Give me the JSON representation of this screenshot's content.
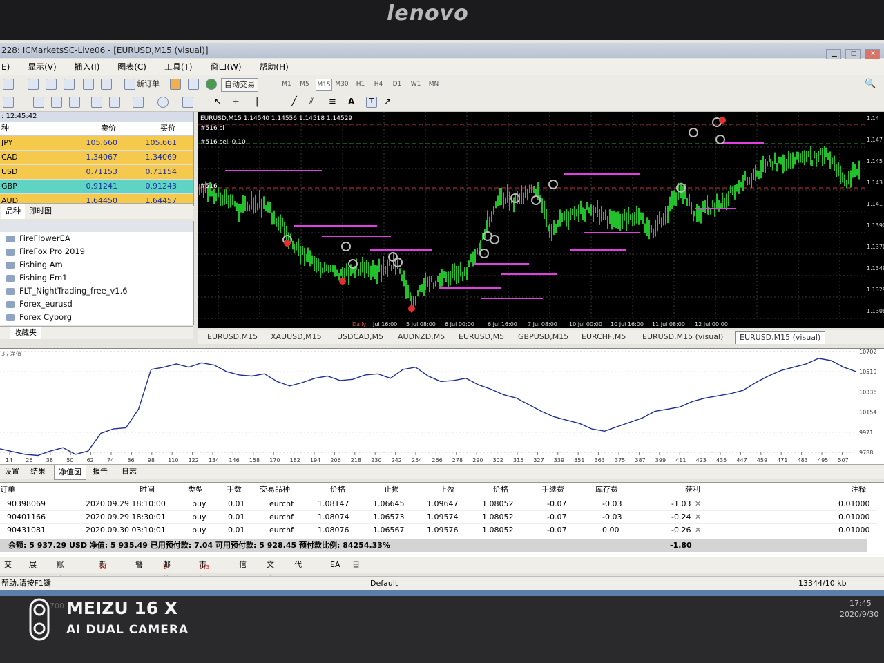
{
  "monitor": {
    "brand": "lenovo"
  },
  "watermark": {
    "line1": "MEIZU 16 X",
    "line2": "AI DUAL CAMERA"
  },
  "window": {
    "title": "228: ICMarketsSC-Live06 - [EURUSD,M15 (visual)]"
  },
  "menu": {
    "items": [
      "显示(V)",
      "插入(I)",
      "图表(C)",
      "工具(T)",
      "窗口(W)",
      "帮助(H)"
    ],
    "file": "E)"
  },
  "toolbar": {
    "new_order": "新订单",
    "auto_trading": "自动交易",
    "timeframes": [
      "M1",
      "M5",
      "M15",
      "M30",
      "H1",
      "H4",
      "D1",
      "W1",
      "MN"
    ],
    "active_timeframe": "M15",
    "text_tool": "A",
    "text_label_tool": "T"
  },
  "market_watch": {
    "time": ": 12:45:42",
    "col_symbol": "种",
    "col_bid": "卖价",
    "col_ask": "买价",
    "rows": [
      {
        "symbol": "JPY",
        "bid": "105.660",
        "ask": "105.661",
        "color": "#f5c94c"
      },
      {
        "symbol": "CAD",
        "bid": "1.34067",
        "ask": "1.34069",
        "color": "#f5c94c"
      },
      {
        "symbol": "USD",
        "bid": "0.71153",
        "ask": "0.71154",
        "color": "#f5c94c"
      },
      {
        "symbol": "GBP",
        "bid": "0.91241",
        "ask": "0.91243",
        "color": "#5fd3c4"
      },
      {
        "symbol": "AUD",
        "bid": "1.64450",
        "ask": "1.64457",
        "color": "#f5c94c"
      }
    ],
    "tabs": [
      "品种",
      "即时图"
    ]
  },
  "navigator": {
    "items": [
      "FireFlowerEA",
      "FireFox Pro 2019",
      "Fishing Am",
      "Fishing Em1",
      "FLT_NightTrading_free_v1.6",
      "Forex_eurusd",
      "Forex Cyborg"
    ],
    "tabs": [
      "收藏夹"
    ]
  },
  "chart": {
    "header": "EURUSD,M15  1.14540 1.14556 1.14518 1.14529",
    "order_label_1": "#516 sl",
    "order_label_2": "#516 sell 0.10",
    "order_label_3": "#516",
    "price_labels": [
      "1.14",
      "1.147",
      "1.145",
      "1.143",
      "1.141",
      "1.1390",
      "1.1370",
      "1.1349",
      "1.1329",
      "1.1308"
    ],
    "time_labels": [
      "Daily",
      "Jul 16:00",
      "5 Jul 08:00",
      "6 Jul 00:00",
      "6 Jul 16:00",
      "7 Jul 08:00",
      "10 Jul 00:00",
      "10 Jul 16:00",
      "11 Jul 08:00",
      "12 Jul 00:00"
    ]
  },
  "chart_tabs": [
    "EURUSD,M15",
    "XAUUSD,M15",
    "USDCAD,M5",
    "AUDNZD,M5",
    "EURUSD,M5",
    "GBPUSD,M15",
    "EURCHF,M5",
    "EURUSD,M15 (visual)",
    "EURUSD,M15 (visual)"
  ],
  "chart_data": [
    {
      "type": "line",
      "title": "",
      "series": [
        {
          "name": "净值",
          "values": [
            9820,
            9795,
            9770,
            9760,
            9800,
            9830,
            9770,
            9800,
            9960,
            10000,
            10010,
            10180,
            10540,
            10560,
            10590,
            10560,
            10600,
            10580,
            10520,
            10490,
            10480,
            10500,
            10430,
            10390,
            10420,
            10460,
            10480,
            10440,
            10450,
            10490,
            10500,
            10460,
            10540,
            10560,
            10480,
            10430,
            10440,
            10460,
            10400,
            10360,
            10310,
            10280,
            10220,
            10160,
            10110,
            10080,
            10050,
            10000,
            9980,
            10020,
            10060,
            10100,
            10160,
            10180,
            10200,
            10250,
            10280,
            10300,
            10320,
            10350,
            10420,
            10480,
            10530,
            10560,
            10590,
            10640,
            10620,
            10560,
            10520
          ]
        }
      ],
      "x_tick_labels": [
        "14",
        "26",
        "38",
        "50",
        "62",
        "74",
        "86",
        "98",
        "110",
        "122",
        "134",
        "146",
        "158",
        "170",
        "182",
        "194",
        "206",
        "218",
        "230",
        "242",
        "254",
        "266",
        "278",
        "290",
        "302",
        "315",
        "327",
        "339",
        "351",
        "363",
        "375",
        "387",
        "399",
        "411",
        "423",
        "435",
        "447",
        "459",
        "471",
        "483",
        "495",
        "507"
      ],
      "y_tick_labels": [
        "10702",
        "10519",
        "10336",
        "10154",
        "9971",
        "9788"
      ],
      "ylim": [
        9788,
        10702
      ]
    }
  ],
  "tester_tabs": [
    "设置",
    "结果",
    "净值图",
    "报告",
    "日志"
  ],
  "active_tester_tab": "净值图",
  "equity_label": "3 / 净值",
  "terminal": {
    "headers": [
      "订单",
      "时间",
      "类型",
      "手数",
      "交易品种",
      "价格",
      "止损",
      "止盈",
      "价格",
      "手续费",
      "库存费",
      "获利",
      "注释"
    ],
    "rows": [
      {
        "order": "90398069",
        "time": "2020.09.29 18:10:00",
        "type": "buy",
        "lots": "0.01",
        "symbol": "eurchf",
        "price": "1.08147",
        "sl": "1.06645",
        "tp": "1.09647",
        "cur": "1.08052",
        "commission": "-0.07",
        "swap": "-0.03",
        "profit": "-1.03",
        "comment": "0.01000"
      },
      {
        "order": "90401166",
        "time": "2020.09.29 18:30:01",
        "type": "buy",
        "lots": "0.01",
        "symbol": "eurchf",
        "price": "1.08074",
        "sl": "1.06573",
        "tp": "1.09574",
        "cur": "1.08052",
        "commission": "-0.07",
        "swap": "-0.03",
        "profit": "-0.24",
        "comment": "0.01000"
      },
      {
        "order": "90431081",
        "time": "2020.09.30 03:10:01",
        "type": "buy",
        "lots": "0.01",
        "symbol": "eurchf",
        "price": "1.08076",
        "sl": "1.06567",
        "tp": "1.09576",
        "cur": "1.08052",
        "commission": "-0.07",
        "swap": "0.00",
        "profit": "-0.26",
        "comment": "0.01000"
      }
    ],
    "summary": "余额: 5 937.29 USD  净值: 5 935.49  已用预付款: 7.04  可用预付款: 5 928.45  预付款比例: 84254.33%",
    "summary_profit": "-1.80",
    "tabs": [
      "交易",
      "展示",
      "账户历史",
      "新闻",
      "警报",
      "邮箱",
      "市场",
      "信号",
      "文章",
      "代码库",
      "EA",
      "日志"
    ],
    "news_badge": "99",
    "mail_badge": "14",
    "market_badge": "143"
  },
  "status": {
    "help": "帮助,请按F1键",
    "profile": "Default",
    "traffic": "13344/10 kb"
  },
  "tray": {
    "time": "17:45",
    "date": "2020/9/30",
    "start_partial": "700"
  }
}
